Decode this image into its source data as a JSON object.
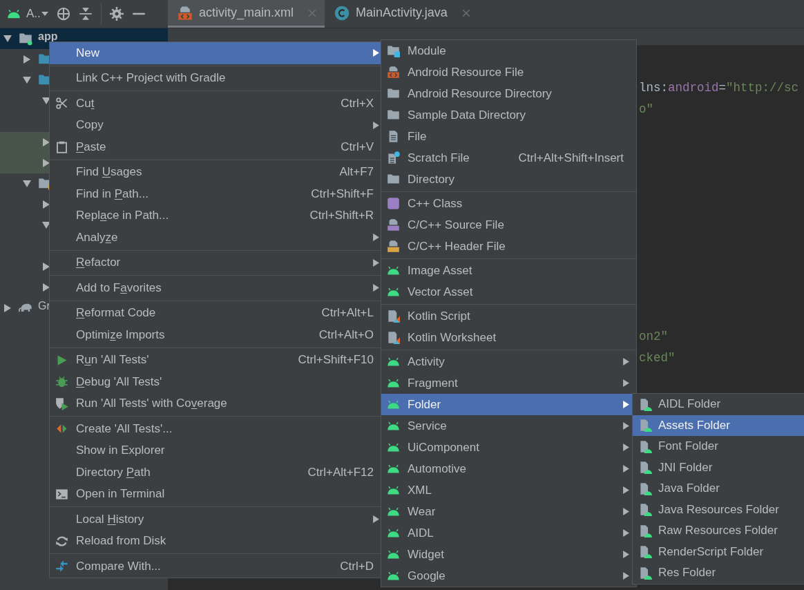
{
  "toolbar": {
    "project_view": "A.."
  },
  "tabs": [
    {
      "label": "activity_main.xml",
      "kind": "resource",
      "selected": true
    },
    {
      "label": "MainActivity.java",
      "kind": "javaclass",
      "selected": false
    }
  ],
  "project_tree": [
    {
      "kind": "module",
      "label": "app",
      "expanded": true,
      "selected": true,
      "highlighted": false,
      "children": [
        {
          "kind": "folder",
          "expanded": false,
          "selected": false,
          "highlighted": false
        },
        {
          "kind": "folder",
          "expanded": true,
          "selected": false,
          "highlighted": false,
          "children": [
            {
              "kind": "node",
              "expanded": true,
              "selected": false,
              "highlighted": false
            },
            {
              "kind": "node",
              "expanded": false,
              "selected": false,
              "highlighted": true
            },
            {
              "kind": "node",
              "expanded": false,
              "selected": false,
              "highlighted": true
            }
          ]
        },
        {
          "kind": "configfolder",
          "expanded": true,
          "selected": false,
          "highlighted": false,
          "children": [
            {
              "kind": "node",
              "expanded": false,
              "selected": false,
              "highlighted": false
            },
            {
              "kind": "node",
              "expanded": true,
              "selected": false,
              "highlighted": false
            },
            {
              "kind": "node",
              "expanded": false,
              "selected": false,
              "highlighted": false
            },
            {
              "kind": "node",
              "expanded": false,
              "selected": false,
              "highlighted": false
            }
          ]
        }
      ]
    },
    {
      "kind": "gradle",
      "label": "Gr",
      "expanded": false,
      "selected": false,
      "highlighted": false
    }
  ],
  "editor": {
    "code_top": [
      [
        {
          "text": "lns:",
          "kind": "plain"
        },
        {
          "text": "android",
          "kind": "attr"
        },
        {
          "text": "=",
          "kind": "plain"
        },
        {
          "text": "\"http://sc",
          "kind": "string"
        }
      ],
      [
        {
          "text": "o\"",
          "kind": "string"
        }
      ]
    ],
    "code_bottom": [
      [
        {
          "text": "on2\"",
          "kind": "string"
        }
      ],
      [
        {
          "text": "cked\"",
          "kind": "string"
        }
      ]
    ]
  },
  "menus": [
    {
      "groups": [
        [
          {
            "label": "New",
            "kind": "plain",
            "selected": true,
            "submenu": true
          }
        ],
        [
          {
            "label": "Link C++ Project with Gradle",
            "kind": "plain",
            "selected": false,
            "submenu": false
          }
        ],
        [
          {
            "label": {
              "pre": "Cu",
              "u": "t"
            },
            "kind": "cut",
            "shortcut": "Ctrl+X",
            "selected": false,
            "submenu": false
          },
          {
            "label": "Copy",
            "kind": "plain",
            "selected": false,
            "submenu": true
          },
          {
            "label": {
              "u": "P",
              "post": "aste"
            },
            "kind": "paste",
            "shortcut": "Ctrl+V",
            "selected": false,
            "submenu": false
          }
        ],
        [
          {
            "label": {
              "pre": "Find ",
              "u": "U",
              "post": "sages"
            },
            "kind": "plain",
            "shortcut": "Alt+F7",
            "selected": false,
            "submenu": false
          },
          {
            "label": {
              "pre": "Find in ",
              "u": "P",
              "post": "ath..."
            },
            "kind": "plain",
            "shortcut": "Ctrl+Shift+F",
            "selected": false,
            "submenu": false
          },
          {
            "label": {
              "pre": "Repl",
              "u": "a",
              "post": "ce in Path..."
            },
            "kind": "plain",
            "shortcut": "Ctrl+Shift+R",
            "selected": false,
            "submenu": false
          },
          {
            "label": {
              "pre": "Analy",
              "u": "z",
              "post": "e"
            },
            "kind": "plain",
            "selected": false,
            "submenu": true
          }
        ],
        [
          {
            "label": {
              "u": "R",
              "post": "efactor"
            },
            "kind": "plain",
            "selected": false,
            "submenu": true
          }
        ],
        [
          {
            "label": {
              "pre": "Add to F",
              "u": "a",
              "post": "vorites"
            },
            "kind": "plain",
            "selected": false,
            "submenu": true
          }
        ],
        [
          {
            "label": {
              "u": "R",
              "post": "eformat Code"
            },
            "kind": "plain",
            "shortcut": "Ctrl+Alt+L",
            "selected": false,
            "submenu": false
          },
          {
            "label": {
              "pre": "Optimi",
              "u": "z",
              "post": "e Imports"
            },
            "kind": "plain",
            "shortcut": "Ctrl+Alt+O",
            "selected": false,
            "submenu": false
          }
        ],
        [
          {
            "label": {
              "pre": "R",
              "u": "u",
              "post": "n 'All Tests'"
            },
            "kind": "run",
            "shortcut": "Ctrl+Shift+F10",
            "selected": false,
            "submenu": false
          },
          {
            "label": {
              "u": "D",
              "post": "ebug 'All Tests'"
            },
            "kind": "debug",
            "selected": false,
            "submenu": false
          },
          {
            "label": {
              "pre": "Run 'All Tests' with Co",
              "u": "v",
              "post": "erage"
            },
            "kind": "coverage",
            "selected": false,
            "submenu": false
          }
        ],
        [
          {
            "label": "Create 'All Tests'...",
            "kind": "tests",
            "selected": false,
            "submenu": false
          },
          {
            "label": "Show in Explorer",
            "kind": "plain",
            "selected": false,
            "submenu": false
          },
          {
            "label": {
              "pre": "Directory ",
              "u": "P",
              "post": "ath"
            },
            "kind": "plain",
            "shortcut": "Ctrl+Alt+F12",
            "selected": false,
            "submenu": false
          },
          {
            "label": "Open in Terminal",
            "kind": "terminal",
            "selected": false,
            "submenu": false
          }
        ],
        [
          {
            "label": {
              "pre": "Local ",
              "u": "H",
              "post": "istory"
            },
            "kind": "plain",
            "selected": false,
            "submenu": true
          },
          {
            "label": "Reload from Disk",
            "kind": "reload",
            "selected": false,
            "submenu": false
          }
        ],
        [
          {
            "label": "Compare With...",
            "kind": "compare",
            "shortcut": "Ctrl+D",
            "selected": false,
            "submenu": false
          }
        ]
      ]
    },
    {
      "groups": [
        [
          {
            "label": "Module",
            "kind": "module",
            "selected": false,
            "submenu": false
          },
          {
            "label": "Android Resource File",
            "kind": "resource",
            "selected": false,
            "submenu": false
          },
          {
            "label": "Android Resource Directory",
            "kind": "folder",
            "selected": false,
            "submenu": false
          },
          {
            "label": "Sample Data Directory",
            "kind": "folder",
            "selected": false,
            "submenu": false
          },
          {
            "label": "File",
            "kind": "file",
            "selected": false,
            "submenu": false
          },
          {
            "label": "Scratch File",
            "kind": "scratch",
            "shortcut": "Ctrl+Alt+Shift+Insert",
            "selected": false,
            "submenu": false
          },
          {
            "label": "Directory",
            "kind": "folder",
            "selected": false,
            "submenu": false
          }
        ],
        [
          {
            "label": "C++ Class",
            "kind": "cppclass",
            "selected": false,
            "submenu": false
          },
          {
            "label": "C/C++ Source File",
            "kind": "cppsource",
            "selected": false,
            "submenu": false
          },
          {
            "label": "C/C++ Header File",
            "kind": "cppheader",
            "selected": false,
            "submenu": false
          }
        ],
        [
          {
            "label": "Image Asset",
            "kind": "android",
            "selected": false,
            "submenu": false
          },
          {
            "label": "Vector Asset",
            "kind": "android",
            "selected": false,
            "submenu": false
          }
        ],
        [
          {
            "label": "Kotlin Script",
            "kind": "kotlin",
            "selected": false,
            "submenu": false
          },
          {
            "label": "Kotlin Worksheet",
            "kind": "kotlin",
            "selected": false,
            "submenu": false
          }
        ],
        [
          {
            "label": "Activity",
            "kind": "android",
            "selected": false,
            "submenu": true
          },
          {
            "label": "Fragment",
            "kind": "android",
            "selected": false,
            "submenu": true
          },
          {
            "label": "Folder",
            "kind": "android",
            "selected": true,
            "submenu": true
          },
          {
            "label": "Service",
            "kind": "android",
            "selected": false,
            "submenu": true
          },
          {
            "label": "UiComponent",
            "kind": "android",
            "selected": false,
            "submenu": true
          },
          {
            "label": "Automotive",
            "kind": "android",
            "selected": false,
            "submenu": true
          },
          {
            "label": "XML",
            "kind": "android",
            "selected": false,
            "submenu": true
          },
          {
            "label": "Wear",
            "kind": "android",
            "selected": false,
            "submenu": true
          },
          {
            "label": "AIDL",
            "kind": "android",
            "selected": false,
            "submenu": true
          },
          {
            "label": "Widget",
            "kind": "android",
            "selected": false,
            "submenu": true
          },
          {
            "label": "Google",
            "kind": "android",
            "selected": false,
            "submenu": true
          }
        ]
      ]
    },
    {
      "groups": [
        [
          {
            "label": "AIDL Folder",
            "kind": "androidfolder",
            "selected": false,
            "submenu": false
          },
          {
            "label": "Assets Folder",
            "kind": "androidfolder",
            "selected": true,
            "submenu": false
          },
          {
            "label": "Font Folder",
            "kind": "androidfolder",
            "selected": false,
            "submenu": false
          },
          {
            "label": "JNI Folder",
            "kind": "androidfolder",
            "selected": false,
            "submenu": false
          },
          {
            "label": "Java Folder",
            "kind": "androidfolder",
            "selected": false,
            "submenu": false
          },
          {
            "label": "Java Resources Folder",
            "kind": "androidfolder",
            "selected": false,
            "submenu": false
          },
          {
            "label": "Raw Resources Folder",
            "kind": "androidfolder",
            "selected": false,
            "submenu": false
          },
          {
            "label": "RenderScript Folder",
            "kind": "androidfolder",
            "selected": false,
            "submenu": false
          },
          {
            "label": "Res Folder",
            "kind": "androidfolder",
            "selected": false,
            "submenu": false
          }
        ]
      ]
    }
  ]
}
